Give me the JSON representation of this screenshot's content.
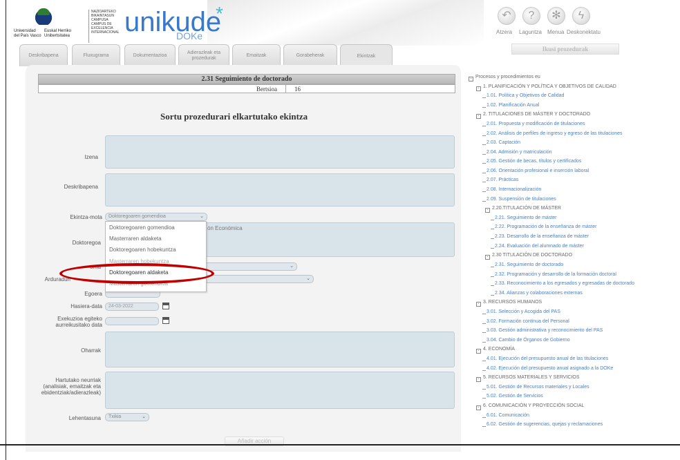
{
  "header": {
    "upv_text_1": "Universidad\ndel País Vasco",
    "upv_text_2": "Euskal Herriko\nUnibertsitatea",
    "small_text": "NAZIOARTEKO\nBIKAINTASUN\nCAMPUSA\nCAMPUS DE\nEXCELENCIA\nINTERNACIONAL",
    "app_name": "unikude",
    "app_suffix": "DOKe",
    "toolbar": [
      {
        "label": "Atzera",
        "icon": "back-arrow-icon",
        "glyph": "↶"
      },
      {
        "label": "Laguntza",
        "icon": "help-icon",
        "glyph": "?"
      },
      {
        "label": "Menua",
        "icon": "menu-snowflake-icon",
        "glyph": "✻"
      },
      {
        "label": "Deskonektatu",
        "icon": "disconnect-bolt-icon",
        "glyph": "ϟ"
      }
    ],
    "print_button": "Ikusi prozedurak"
  },
  "tabs": [
    "Deskribapena",
    "Fluxugrama",
    "Dokumentazioa",
    "Adierazleak eta prozedurak",
    "Emaitzak",
    "Gorabeherak",
    "Ekintzak"
  ],
  "process": {
    "title": "2.31 Seguimiento de doctorado",
    "version_label": "Bertsioa",
    "version_value": "16"
  },
  "form": {
    "title": "Sortu prozedurari elkartutako ekintza",
    "labels": {
      "izena": "Izena",
      "deskribapena": "Deskribapena",
      "ekintza_mota": "Ekintza-mota",
      "doktoregoa": "Doktoregoa",
      "arduradun_partial": "Arduradun",
      "orria_partial": "orria",
      "egoera": "Egoera",
      "hasiera_data": "Hasiera-data",
      "exekuzioa": "Exekuzioa egiteko\naurreikusitako data",
      "oharrak": "Oharrak",
      "hartutako": "Hartutako neurriak\n(analisiak, emaitzak eta\nebidentziak/adierazleak)",
      "lehentasuna": "Lehentasuna"
    },
    "ekintza_mota_value": "Doktoregoaren gomendioa",
    "doktoregoa_text": "ón Económica",
    "hasiera_data_value": "24-03-2022",
    "lehentasuna_value": "Txikia",
    "add_button": "Añadir acción",
    "dropdown_options": [
      "Doktoregoaren gomendioa",
      "Masterraren aldaketa",
      "Doktoregoaren hobekuntza",
      "Masterraren hobekuntza",
      "Doktoregoaren aldaketa",
      "Masterraren gomendioa"
    ]
  },
  "tree": {
    "root": "Procesos y procedimientos eu",
    "nodes": [
      {
        "text": "1. PLANIFICACIÓN Y POLÍTICA Y OBJETIVOS DE CALIDAD",
        "level": 1,
        "link": false
      },
      {
        "text": "1.01. Política y Objetivos de Calidad",
        "level": 2,
        "link": true
      },
      {
        "text": "1.02. Planificación Anual",
        "level": 2,
        "link": true
      },
      {
        "text": "2. TITULACIONES DE MÁSTER Y DOCTORADO",
        "level": 1,
        "link": false
      },
      {
        "text": "2.01. Propuesta y modificación de titulaciones",
        "level": 2,
        "link": true
      },
      {
        "text": "2.02. Análisis de perfiles de ingreso y egreso de las titulaciones",
        "level": 2,
        "link": true
      },
      {
        "text": "2.03. Captación",
        "level": 2,
        "link": true
      },
      {
        "text": "2.04. Admisión y matriculación",
        "level": 2,
        "link": true
      },
      {
        "text": "2.05. Gestión de becas, títulos y certificados",
        "level": 2,
        "link": true
      },
      {
        "text": "2.06. Orientación profesional e inserción laboral",
        "level": 2,
        "link": true
      },
      {
        "text": "2.07. Prácticas",
        "level": 2,
        "link": true
      },
      {
        "text": "2.08. Internacionalización",
        "level": 2,
        "link": true
      },
      {
        "text": "2.09. Suspensión de titulaciones",
        "level": 2,
        "link": true
      },
      {
        "text": "2.20.TITULACIÓN DE MÁSTER",
        "level": 2,
        "link": false
      },
      {
        "text": "2.21. Seguimiento de máster",
        "level": 3,
        "link": true
      },
      {
        "text": "2.22. Programación de la enseñanza de máster",
        "level": 3,
        "link": true
      },
      {
        "text": "2.23. Desarrollo de la enseñanza de máster",
        "level": 3,
        "link": true
      },
      {
        "text": "2.24. Evaluación del alumnado de máster",
        "level": 3,
        "link": true
      },
      {
        "text": "2.30 TITULACIÓN DE DOCTORADO",
        "level": 2,
        "link": false
      },
      {
        "text": "2.31. Seguimiento de doctorado",
        "level": 3,
        "link": true
      },
      {
        "text": "2.32. Programación y desarrollo de la formación doctoral",
        "level": 3,
        "link": true
      },
      {
        "text": "2.33. Reconocimiento a los egresados y egresadas de doctorado",
        "level": 3,
        "link": true
      },
      {
        "text": "2.34. Alianzas y colaboraciones externas",
        "level": 3,
        "link": true
      },
      {
        "text": "3. RECURSOS HUMANOS",
        "level": 1,
        "link": false
      },
      {
        "text": "3.01. Selección y Acogida del PAS",
        "level": 2,
        "link": true
      },
      {
        "text": "3.02. Formación continua del Personal",
        "level": 2,
        "link": true
      },
      {
        "text": "3.03. Gestión administrativa y reconocimiento del PAS",
        "level": 2,
        "link": true
      },
      {
        "text": "3.04. Cambio de Órganos de Gobierno",
        "level": 2,
        "link": true
      },
      {
        "text": "4. ECONOMÍA",
        "level": 1,
        "link": false
      },
      {
        "text": "4.01. Ejecución del presupuesto anual de las titulaciones",
        "level": 2,
        "link": true
      },
      {
        "text": "4.02. Ejecución del presupuesto anual asignado a la DOKe",
        "level": 2,
        "link": true
      },
      {
        "text": "5. RECURSOS MATERIALES Y SERVICIOS",
        "level": 1,
        "link": false
      },
      {
        "text": "5.01. Gestión de Recursos materiales y Locales",
        "level": 2,
        "link": true
      },
      {
        "text": "5.02. Gestión de Servicios",
        "level": 2,
        "link": true
      },
      {
        "text": "6. COMUNICACIÓN Y PROYECCIÓN SOCIAL",
        "level": 1,
        "link": false
      },
      {
        "text": "6.01. Comunicación",
        "level": 2,
        "link": true
      },
      {
        "text": "6.02. Gestión de sugerencias, quejas y reclamaciones",
        "level": 2,
        "link": true
      }
    ]
  }
}
